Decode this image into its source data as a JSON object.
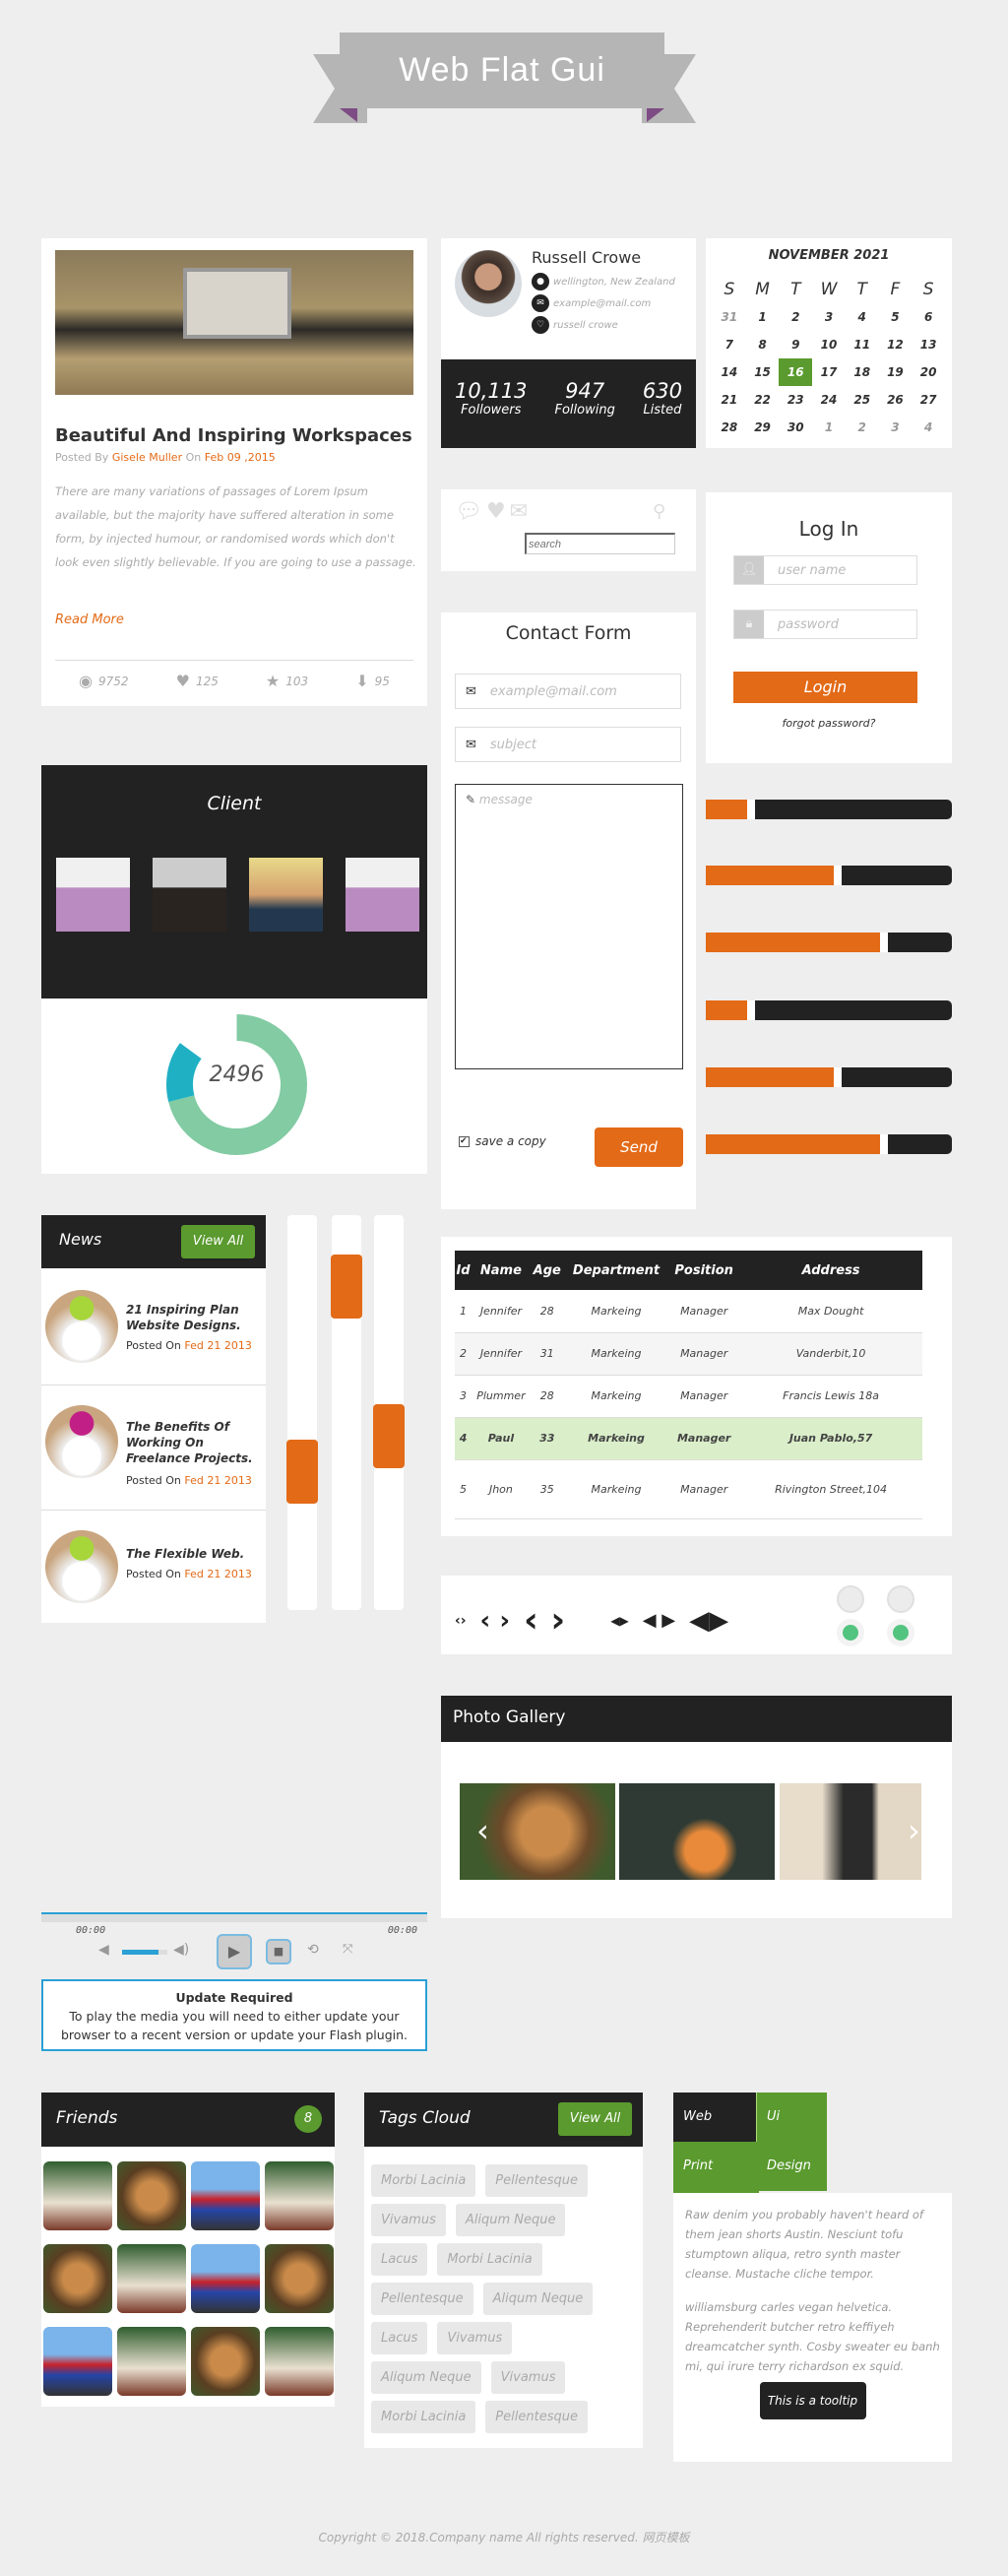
{
  "banner": {
    "title": "Web Flat Gui"
  },
  "blog": {
    "title": "Beautiful And Inspiring Workspaces",
    "posted_by": "Posted By",
    "author": "Gisele Muller",
    "on": "On",
    "date": "Feb 09 ,2015",
    "body": "There are many variations of passages of Lorem Ipsum available, but the majority have suffered alteration in some form, by injected humour, or randomised words which don't look even slightly believable. If you are going to use a passage.",
    "read_more": "Read More",
    "stats": {
      "views": "9752",
      "likes": "125",
      "stars": "103",
      "downloads": "95"
    }
  },
  "profile": {
    "name": "Russell Crowe",
    "location": "wellington, New Zealand",
    "email": "example@mail.com",
    "handle": "russell crowe",
    "stats": [
      {
        "value": "10,113",
        "label": "Followers"
      },
      {
        "value": "947",
        "label": "Following"
      },
      {
        "value": "630",
        "label": "Listed"
      }
    ]
  },
  "calendar": {
    "title": "NOVEMBER 2021",
    "days": [
      "S",
      "M",
      "T",
      "W",
      "T",
      "F",
      "S"
    ],
    "cells": [
      "31",
      "1",
      "2",
      "3",
      "4",
      "5",
      "6",
      "7",
      "8",
      "9",
      "10",
      "11",
      "12",
      "13",
      "14",
      "15",
      "16",
      "17",
      "18",
      "19",
      "20",
      "21",
      "22",
      "23",
      "24",
      "25",
      "26",
      "27",
      "28",
      "29",
      "30",
      "1",
      "2",
      "3",
      "4"
    ],
    "today": "16"
  },
  "search": {
    "placeholder": "search"
  },
  "login": {
    "title": "Log In",
    "username_placeholder": "user name",
    "password_placeholder": "password",
    "button": "Login",
    "forgot": "forgot password?"
  },
  "contact": {
    "title": "Contact Form",
    "email_placeholder": "example@mail.com",
    "subject_placeholder": "subject",
    "message_placeholder": "message",
    "save_copy": "save a copy",
    "save_copy_checked": true,
    "send": "Send"
  },
  "client": {
    "title": "Client",
    "donut": {
      "value": "2496",
      "segments_percent": [
        {
          "color": "#82cba3",
          "percent": 71
        },
        {
          "color": "#1fb0c4",
          "percent": 14
        }
      ]
    }
  },
  "progress_bars_percent": [
    20,
    55,
    74,
    20,
    55,
    74
  ],
  "colors": {
    "accent": "#e36a17",
    "green": "#5a9a2e",
    "dark": "#222222",
    "table_highlight": "#d9eec9"
  },
  "news": {
    "title": "News",
    "view_all": "View All",
    "items": [
      {
        "title": "21 Inspiring Plan Website Designs.",
        "posted": "Posted On",
        "date": "Fed 21 2013"
      },
      {
        "title": "The Benefits Of Working On Freelance Projects.",
        "posted": "Posted On",
        "date": "Fed 21 2013"
      },
      {
        "title": "The Flexible Web.",
        "posted": "Posted On",
        "date": "Fed 21 2013"
      }
    ]
  },
  "vertical_sliders_percent": [
    68,
    12,
    57
  ],
  "table": {
    "headers": [
      "Id",
      "Name",
      "Age",
      "Department",
      "Position",
      "Address"
    ],
    "rows": [
      [
        "1",
        "Jennifer",
        "28",
        "Markeing",
        "Manager",
        "Max Dought"
      ],
      [
        "2",
        "Jennifer",
        "31",
        "Markeing",
        "Manager",
        "Vanderbit,10"
      ],
      [
        "3",
        "Plummer",
        "28",
        "Markeing",
        "Manager",
        "Francis Lewis 18a"
      ],
      [
        "4",
        "Paul",
        "33",
        "Markeing",
        "Manager",
        "Juan Pablo,57"
      ],
      [
        "5",
        "Jhon",
        "35",
        "Markeing",
        "Manager",
        "Rivington Street,104"
      ]
    ],
    "highlighted_row": 4
  },
  "toggles": [
    {
      "on": true
    },
    {
      "on": true
    }
  ],
  "gallery": {
    "title": "Photo Gallery"
  },
  "media": {
    "time_current": "00:00",
    "time_total": "00:00",
    "volume_percent": 80,
    "update_title": "Update Required",
    "update_text": "To play the media you will need to either update your browser to a recent version or update your Flash plugin."
  },
  "friends": {
    "title": "Friends",
    "count": "8"
  },
  "tags": {
    "title": "Tags Cloud",
    "view_all": "View All",
    "items": [
      "Morbi Lacinia",
      "Pellentesque",
      "Vivamus",
      "Aliqum Neque",
      "Lacus",
      "Morbi Lacinia",
      "Pellentesque",
      "Aliqum Neque",
      "Lacus",
      "Vivamus",
      "Aliqum Neque",
      "Vivamus",
      "Morbi Lacinia",
      "Pellentesque"
    ]
  },
  "tabs": {
    "items": [
      "Web Design",
      "Ui Design",
      "Print Design"
    ],
    "active": "Web Design",
    "para1": "Raw denim you probably haven't heard of them jean shorts Austin. Nesciunt tofu stumptown aliqua, retro synth master cleanse. Mustache cliche tempor.",
    "para2": "williamsburg carles vegan helvetica. Reprehenderit butcher retro keffiyeh dreamcatcher synth. Cosby sweater eu banh mi, qui irure terry richardson ex squid.",
    "tooltip": "This is a tooltip"
  },
  "footer": {
    "copyright": "Copyright © 2018.Company name All rights reserved.",
    "link": "网页模板"
  }
}
